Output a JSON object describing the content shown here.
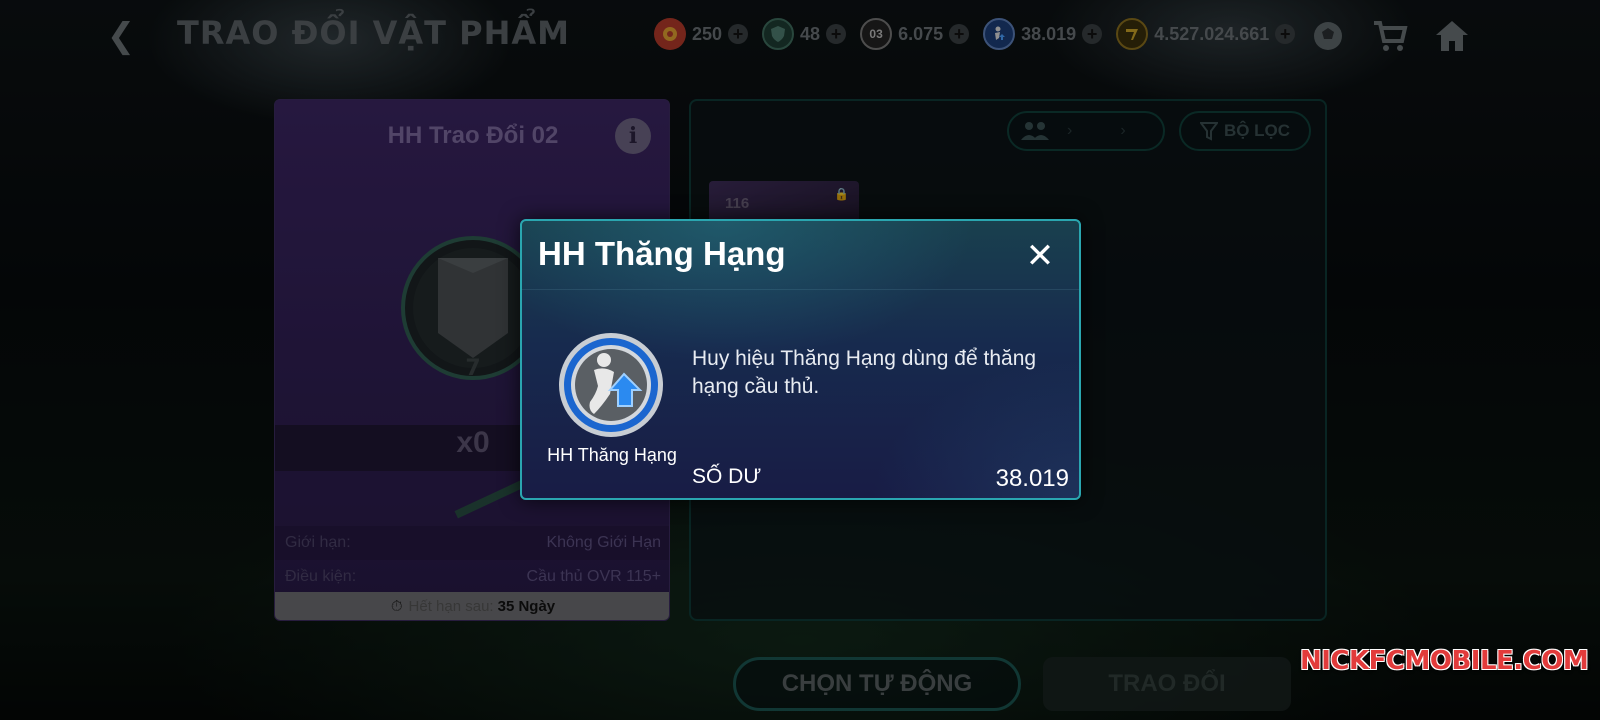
{
  "header": {
    "title": "TRAO ĐỔI VẬT PHẨM",
    "currencies": [
      {
        "icon": "red-token-icon",
        "value": "250",
        "color": "#c0392b"
      },
      {
        "icon": "shield-token-icon",
        "value": "48",
        "color": "#2e6d55"
      },
      {
        "icon": "card-token-icon",
        "value": "6.075",
        "color": "#d8d8d8",
        "badge_text": "03"
      },
      {
        "icon": "promotion-badge-icon",
        "value": "38.019",
        "color": "#2a62c8"
      },
      {
        "icon": "fc-points-icon",
        "value": "4.527.024.661",
        "color": "#c9a227"
      }
    ],
    "icons": [
      "ball-icon",
      "cart-icon",
      "home-icon"
    ]
  },
  "left_card": {
    "title": "HH Trao Đổi 02",
    "count": "x0",
    "rows": [
      {
        "key": "Giới hạn:",
        "value": "Không Giới Hạn"
      },
      {
        "key": "Điều kiện:",
        "value": "Cầu thủ OVR 115+"
      }
    ],
    "expiry_label": "Hết hạn sau:",
    "expiry_value": "35 Ngày"
  },
  "right_panel": {
    "filter_label": "BỘ LỌC",
    "player_ovr": "116"
  },
  "buttons": {
    "auto_select": "CHỌN TỰ ĐỘNG",
    "trade": "TRAO ĐỔI"
  },
  "modal": {
    "title": "HH Thăng Hạng",
    "item_label": "HH Thăng Hạng",
    "description": "Huy hiệu Thăng Hạng dùng để thăng hạng cầu thủ.",
    "balance_label": "SỐ DƯ",
    "balance_value": "38.019"
  },
  "watermark": "NICKFCMOBILE.COM"
}
